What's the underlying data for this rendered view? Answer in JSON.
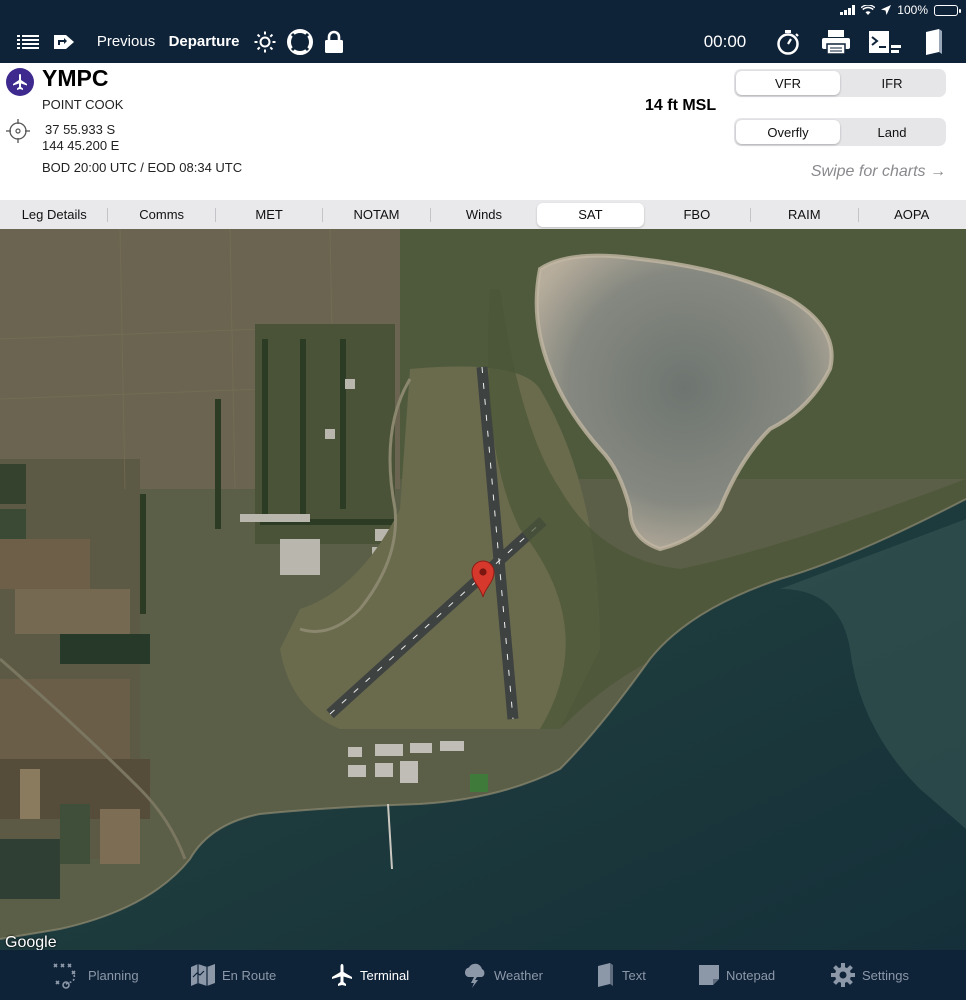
{
  "status": {
    "battery_percent": "100%",
    "battery_level": 1.0
  },
  "topnav": {
    "previous_label": "Previous",
    "departure_label": "Departure",
    "timer": "00:00",
    "icons": [
      "list-icon",
      "route-direction-icon",
      "brightness-icon",
      "lifebuoy-icon",
      "lock-icon",
      "stopwatch-icon",
      "printer-icon",
      "chart-clip-icon",
      "document-icon"
    ]
  },
  "airport": {
    "code": "YMPC",
    "name": "POINT COOK",
    "latitude": "37 55.933 S",
    "longitude": "144 45.200 E",
    "daylight": "BOD 20:00 UTC / EOD 08:34 UTC",
    "elevation": "14 ft MSL",
    "flight_rules": {
      "options": [
        "VFR",
        "IFR"
      ],
      "selected": "VFR"
    },
    "approach": {
      "options": [
        "Overfly",
        "Land"
      ],
      "selected": "Overfly"
    },
    "swipe_hint": "Swipe for charts →"
  },
  "tabs": {
    "items": [
      "Leg Details",
      "Comms",
      "MET",
      "NOTAM",
      "Winds",
      "SAT",
      "FBO",
      "RAIM",
      "AOPA"
    ],
    "selected": "SAT"
  },
  "map": {
    "attribution": "Google",
    "marker_icon": "map-pin-icon"
  },
  "bottom_nav": {
    "items": [
      {
        "label": "Planning",
        "icon": "planning-icon"
      },
      {
        "label": "En Route",
        "icon": "map-folded-icon"
      },
      {
        "label": "Terminal",
        "icon": "airplane-icon"
      },
      {
        "label": "Weather",
        "icon": "cloud-lightning-icon"
      },
      {
        "label": "Text",
        "icon": "document-icon"
      },
      {
        "label": "Notepad",
        "icon": "notepad-icon"
      },
      {
        "label": "Settings",
        "icon": "gear-icon"
      }
    ],
    "selected": "Terminal"
  },
  "colors": {
    "nav_background": "#0e2238",
    "accent_airport": "#3e2a8e",
    "marker": "#d7382c"
  }
}
